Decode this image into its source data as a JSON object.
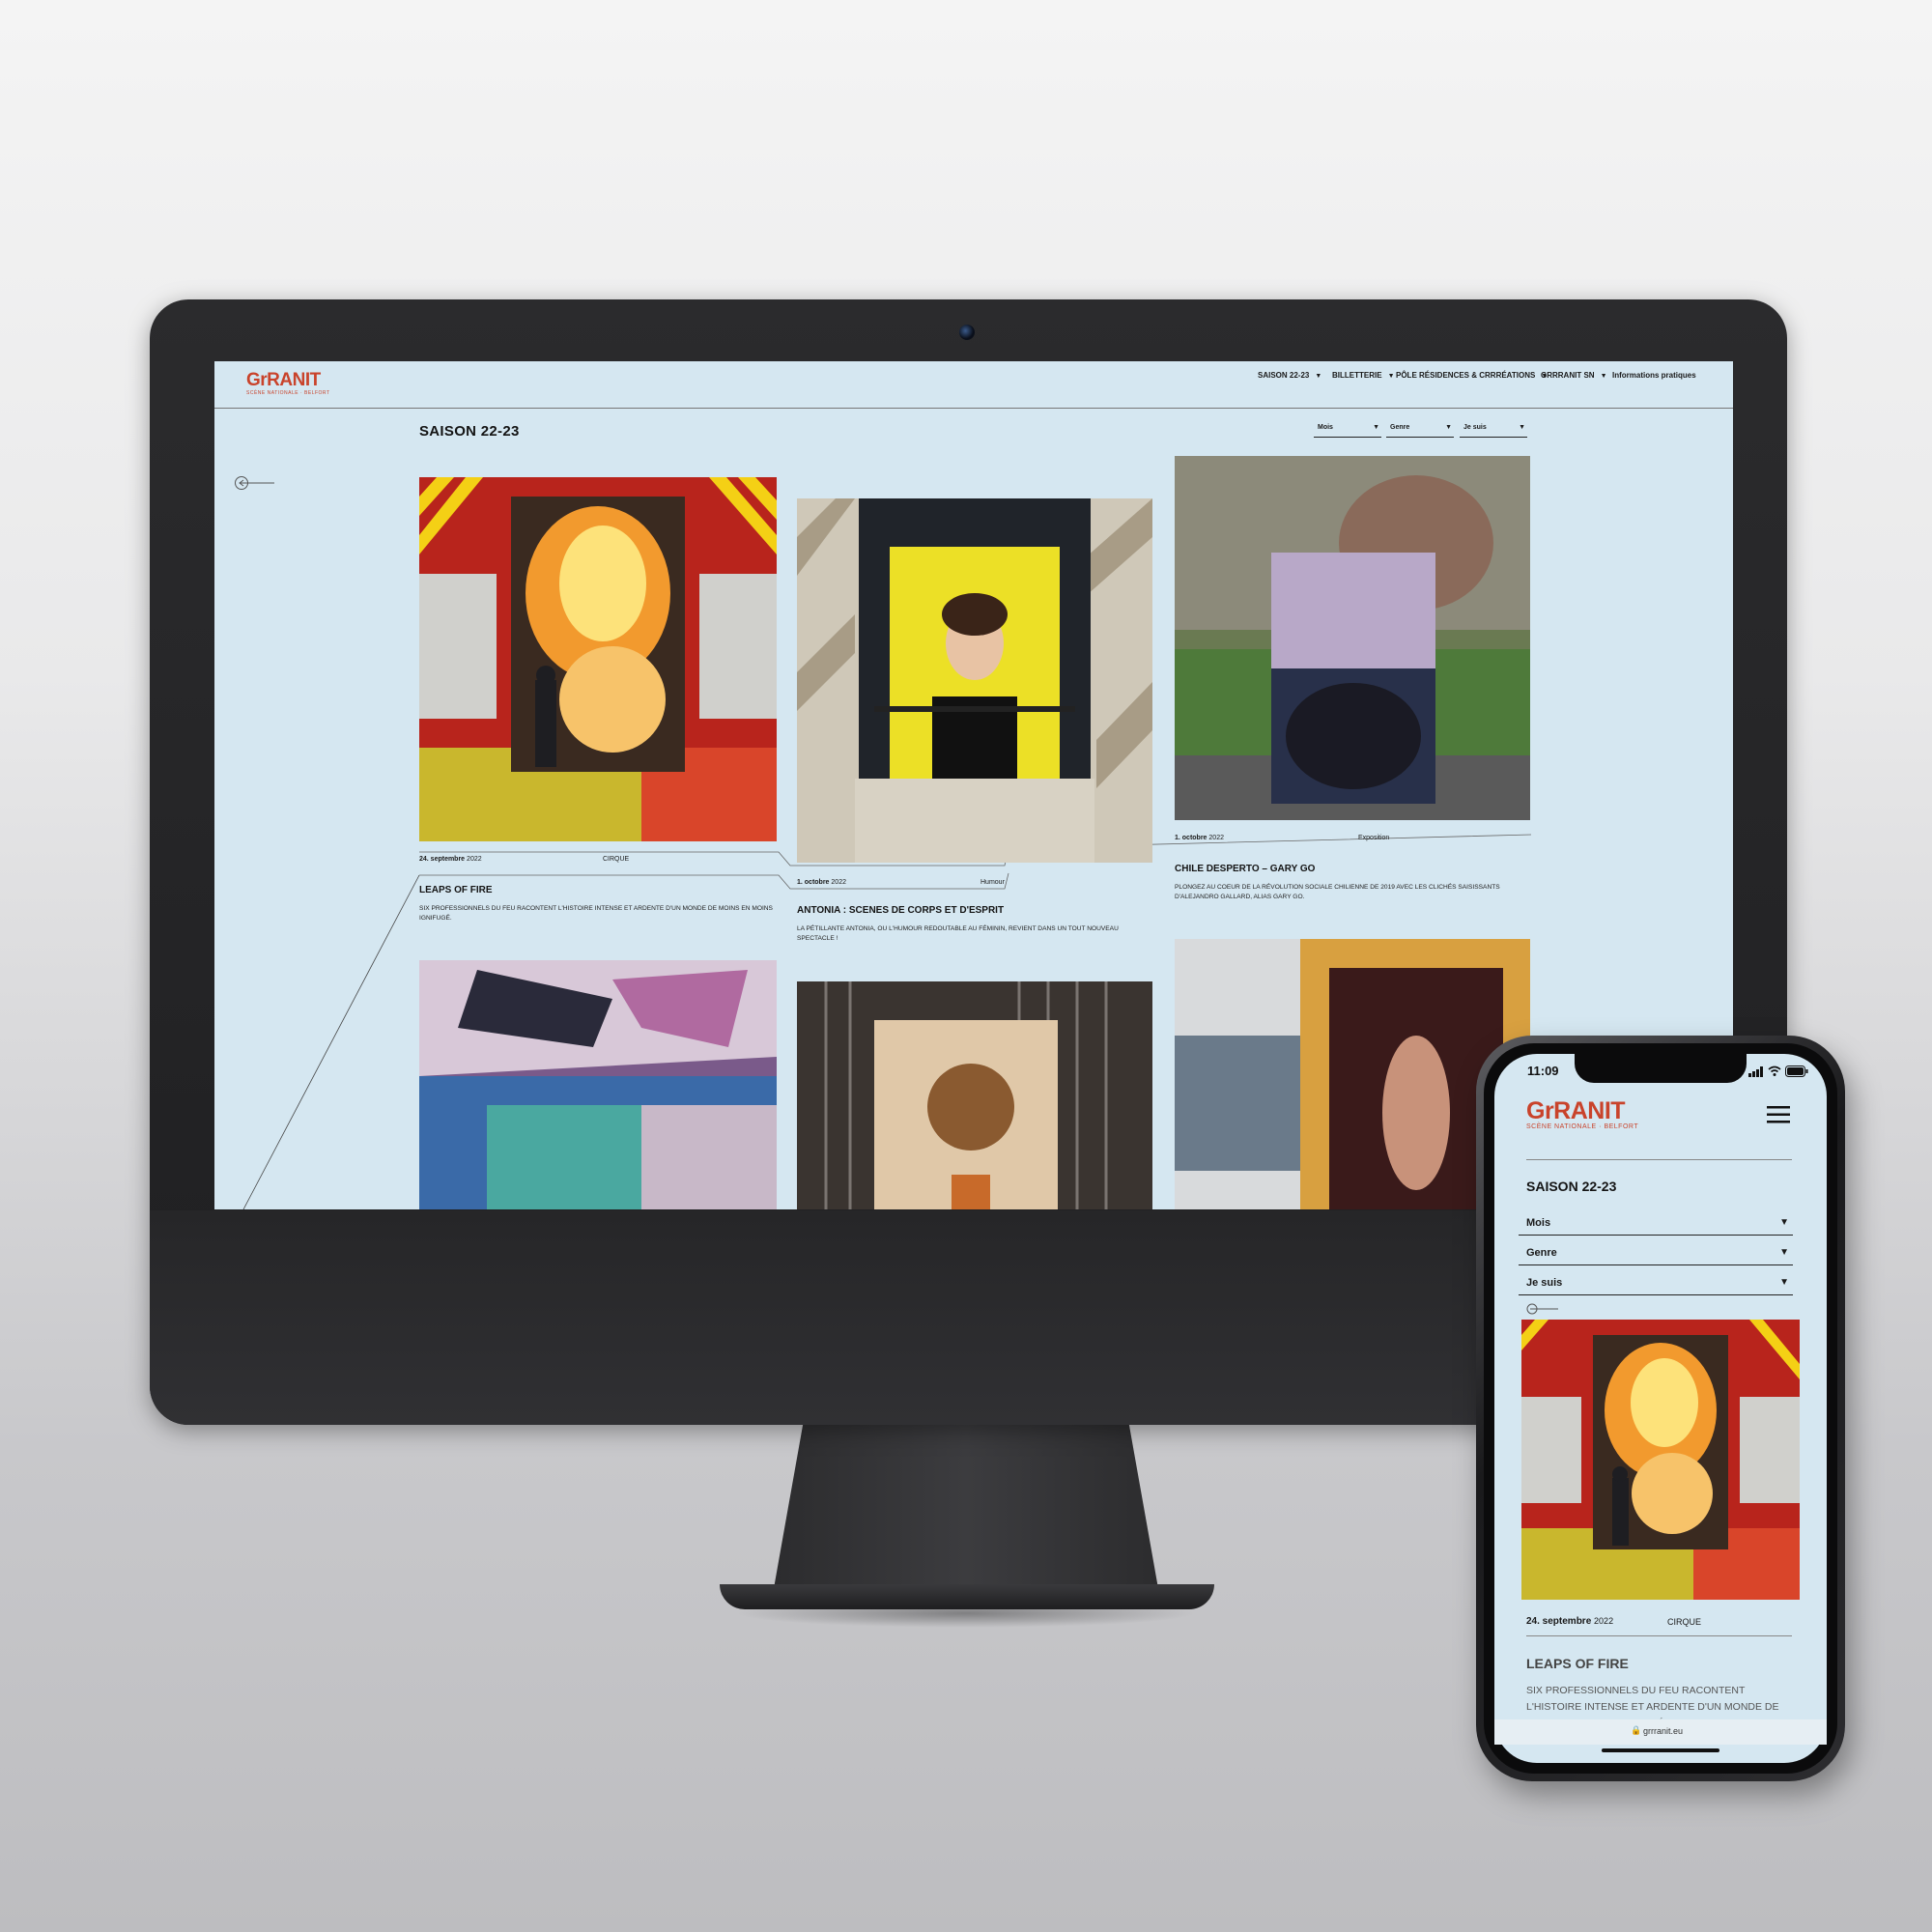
{
  "desktop": {
    "logo": {
      "main": "GrRANIT",
      "sub": "SCÈNE NATIONALE · BELFORT"
    },
    "nav": [
      {
        "label": "SAISON 22-23",
        "caret": "▼"
      },
      {
        "label": "BILLETTERIE",
        "caret": "▼"
      },
      {
        "label": "PÔLE RÉSIDENCES & CRRRÉATIONS",
        "caret": "▼"
      },
      {
        "label": "GRRRANIT SN",
        "caret": "▼"
      },
      {
        "label": "Informations pratiques"
      }
    ],
    "page_title": "SAISON 22-23",
    "filters": [
      {
        "label": "Mois",
        "caret": "▼"
      },
      {
        "label": "Genre",
        "caret": "▼"
      },
      {
        "label": "Je suis",
        "caret": "▼"
      }
    ],
    "cards": [
      {
        "date": "24. septembre",
        "year": "2022",
        "genre": "CIRQUE",
        "title": "LEAPS OF FIRE",
        "desc": "SIX PROFESSIONNELS DU FEU RACONTENT L'HISTOIRE INTENSE ET ARDENTE D'UN MONDE DE MOINS EN MOINS IGNIFUGÉ."
      },
      {
        "date": "1. octobre",
        "year": "2022",
        "genre": "Humour",
        "title": "ANTONIA : SCENES DE CORPS ET D'ESPRIT",
        "desc": "LA PÉTILLANTE ANTONIA, OU L'HUMOUR REDOUTABLE AU FÉMININ, REVIENT DANS UN TOUT NOUVEAU SPECTACLE !"
      },
      {
        "date": "1. octobre",
        "year": "2022",
        "genre": "Exposition",
        "title": "CHILE DESPERTO – GARY GO",
        "desc": "PLONGEZ AU COEUR DE LA RÉVOLUTION SOCIALE CHILIENNE DE 2019 AVEC LES CLICHÉS SAISISSANTS D'ALEJANDRO GALLARD, ALIAS GARY GO."
      }
    ],
    "icons": {
      "back": "back-arrow-icon"
    }
  },
  "mobile": {
    "status_time": "11:09",
    "logo": {
      "main": "GrRANIT",
      "sub": "SCÈNE NATIONALE · BELFORT"
    },
    "page_title": "SAISON 22-23",
    "filters": [
      {
        "label": "Mois",
        "caret": "▼"
      },
      {
        "label": "Genre",
        "caret": "▼"
      },
      {
        "label": "Je suis",
        "caret": "▼"
      }
    ],
    "card": {
      "date": "24. septembre",
      "year": "2022",
      "genre": "CIRQUE",
      "title": "LEAPS OF FIRE",
      "desc": "SIX PROFESSIONNELS DU FEU RACONTENT L'HISTOIRE INTENSE ET ARDENTE D'UN MONDE DE MOINS EN MOINS IGNIFUGÉ."
    },
    "url": "grrranit.eu",
    "icons": {
      "menu": "hamburger-menu-icon",
      "lock": "lock-icon",
      "signal": "signal-icon",
      "wifi": "wifi-icon",
      "battery": "battery-icon"
    }
  },
  "colors": {
    "brand": "#c9432b",
    "background": "#d5e7f1",
    "text": "#141414"
  }
}
